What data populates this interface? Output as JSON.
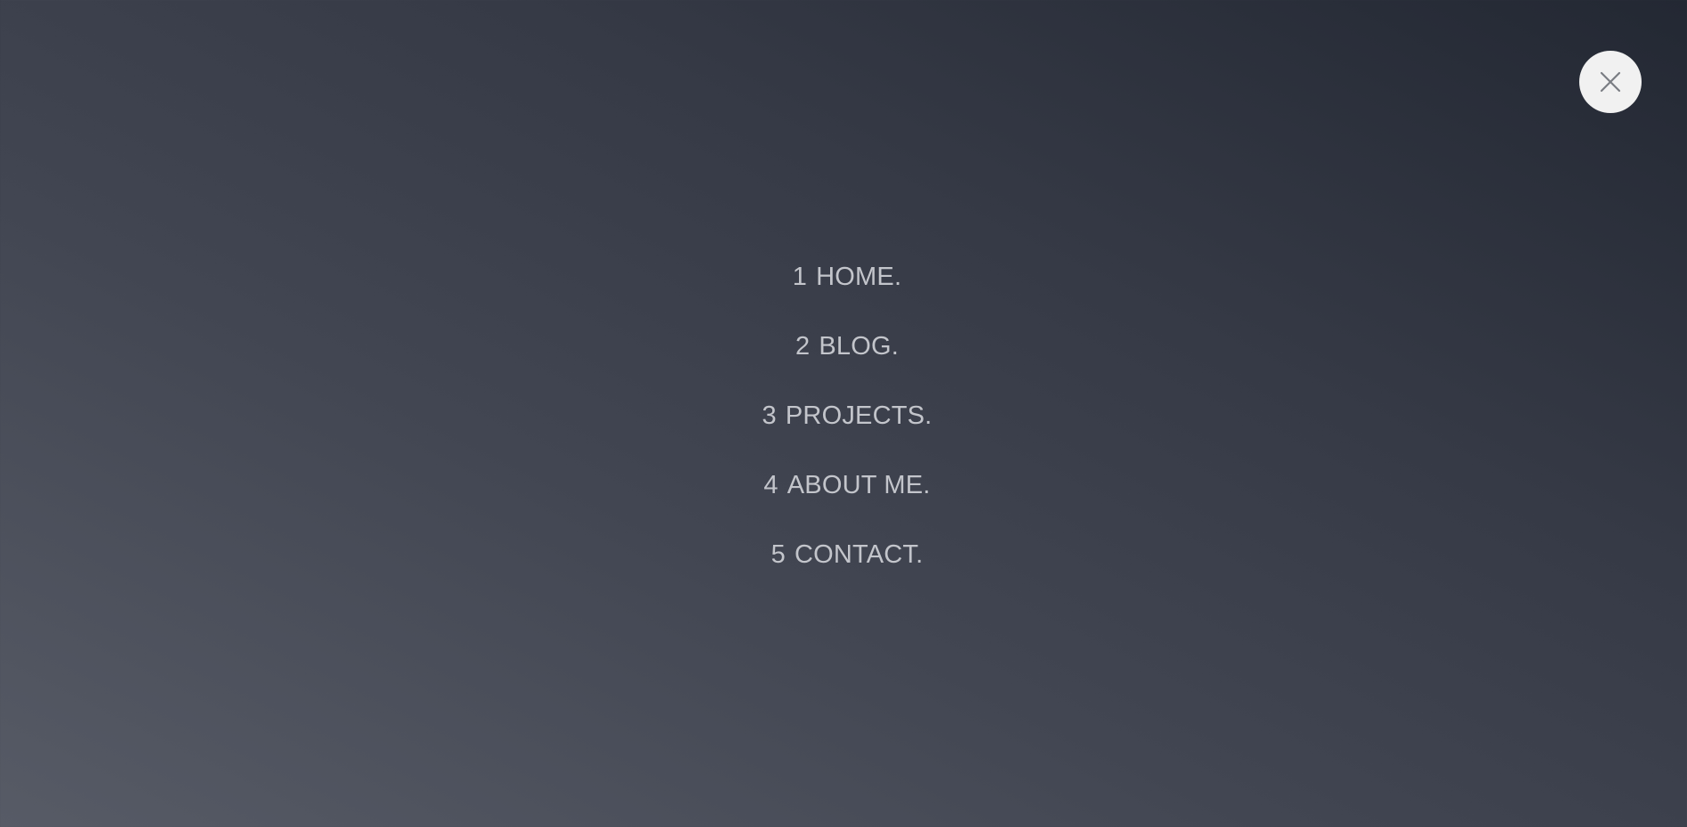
{
  "close_button": {
    "icon": "close-icon",
    "icon_color": "#7a7d83",
    "background": "#f1f1f1"
  },
  "nav": {
    "text_color": "#c3c5cb",
    "items": [
      {
        "number": "1",
        "label": "HOME."
      },
      {
        "number": "2",
        "label": "BLOG."
      },
      {
        "number": "3",
        "label": "PROJECTS."
      },
      {
        "number": "4",
        "label": "ABOUT ME."
      },
      {
        "number": "5",
        "label": "CONTACT."
      }
    ]
  }
}
